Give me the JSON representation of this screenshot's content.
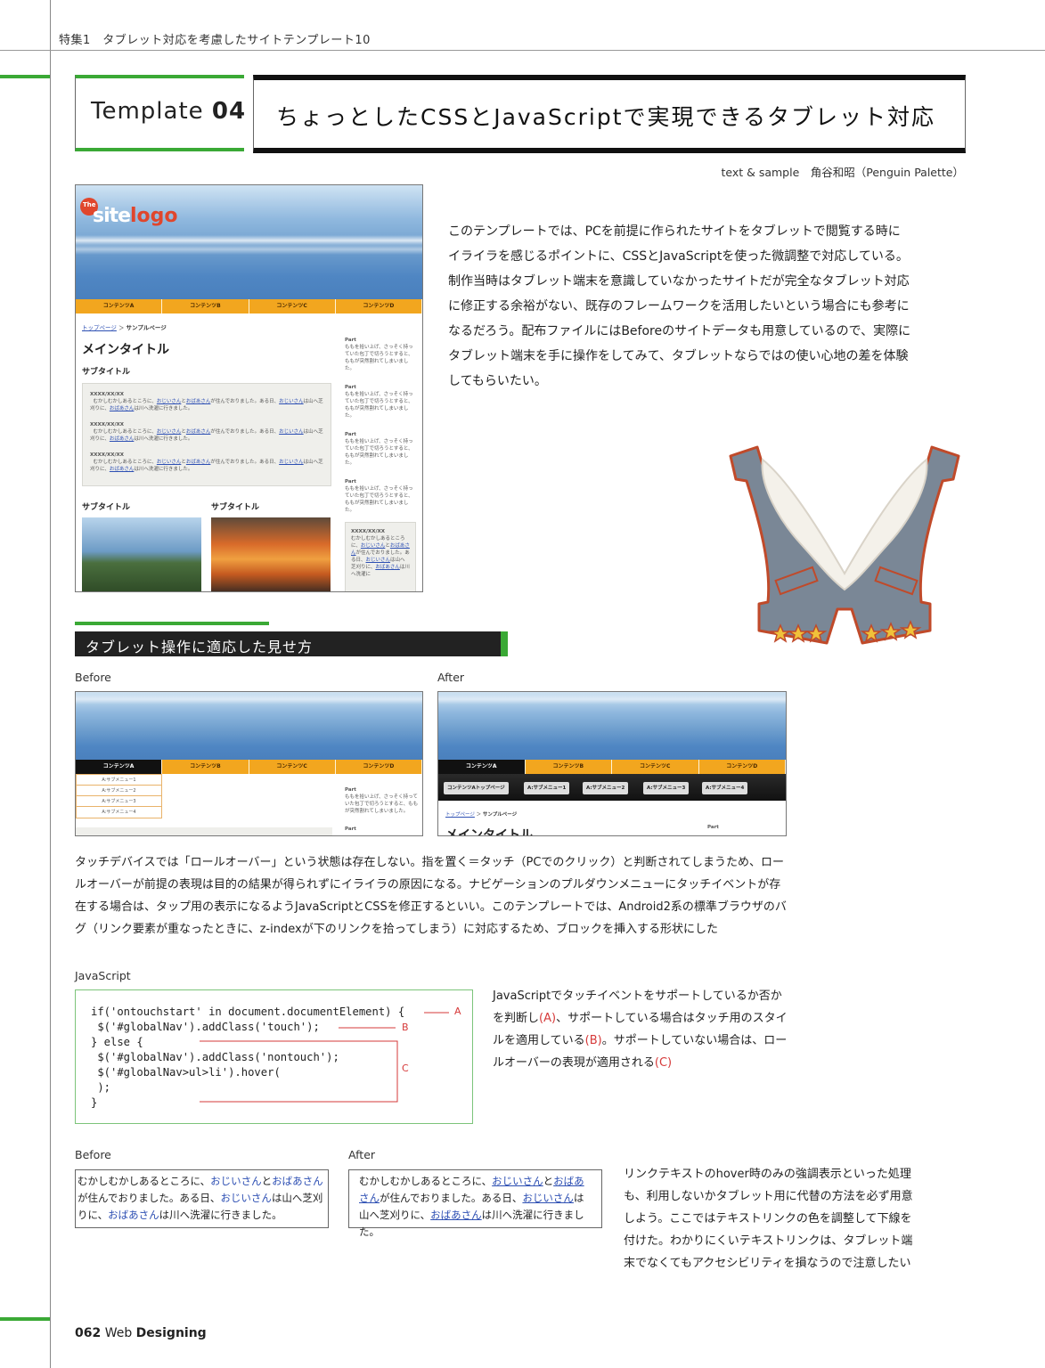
{
  "running_head": "特集1　タブレット対応を考慮したサイトテンプレート10",
  "template": {
    "prefix": "Template",
    "number": "04"
  },
  "title": "ちょっとしたCSSとJavaScriptで実現できるタブレット対応",
  "byline": "text & sample　角谷和昭（Penguin Palette）",
  "intro": "このテンプレートでは、PCを前提に作られたサイトをタブレットで閲覧する時にイライラを感じるポイントに、CSSとJavaScriptを使った微調整で対応している。制作当時はタブレット端末を意識していなかったサイトだが完全なタブレット対応に修正する余裕がない、既存のフレームワークを活用したいという場合にも参考になるだろう。配布ファイルにはBeforeのサイトデータも用意しているので、実際にタブレット端末を手に操作をしてみて、タブレットならではの使い心地の差を体験してもらいたい。",
  "mockup": {
    "logo_the": "The",
    "logo_site": "site",
    "logo_rest": "logo",
    "nav": [
      "コンテンツA",
      "コンテンツB",
      "コンテンツC",
      "コンテンツD"
    ],
    "breadcrumb_home": "トップページ",
    "breadcrumb_sep": "＞",
    "breadcrumb_current": "サンプルページ",
    "main_title": "メインタイトル",
    "sub_title": "サブタイトル",
    "date": "XXXX/XX/XX",
    "story_a": "むかしむかしあるところに、",
    "story_link1": "おじいさん",
    "story_and": "と",
    "story_link2": "おばあさん",
    "story_b": "が住んでおりました。ある日、",
    "story_c": "は山へ芝刈りに、",
    "story_d": "は川へ洗濯に行きました。",
    "side_part": "Part",
    "side_text": "ももを拾い上げ、さっそく持っていた包丁で切ろうとすると、ももが突然割れてしまいました。",
    "side_box_a": "むかしむかしあるところに、",
    "side_box_b": "が住んでおりました。ある日、",
    "side_box_c": "は山へ芝刈りに、",
    "side_box_d": "は川へ洗濯に"
  },
  "section_title": "タブレット操作に適応した見せ方",
  "before_label": "Before",
  "after_label": "After",
  "before_submenu": [
    "A:サブメニュー1",
    "A:サブメニュー2",
    "A:サブメニュー3",
    "A:サブメニュー4"
  ],
  "after_submenu": [
    "コンテンツAトップページ",
    "A:サブメニュー1",
    "A:サブメニュー2",
    "A:サブメニュー3",
    "A:サブメニュー4"
  ],
  "body_text": "タッチデバイスでは「ロールオーバー」という状態は存在しない。指を置く＝タッチ（PCでのクリック）と判断されてしまうため、ロールオーバーが前提の表現は目的の結果が得られずにイライラの原因になる。ナビゲーションのプルダウンメニューにタッチイベントが存在する場合は、タップ用の表示になるようJavaScriptとCSSを修正するといい。このテンプレートでは、Android2系の標準ブラウザのバグ（リンク要素が重なったときに、z-indexが下のリンクを拾ってしまう）に対応するため、ブロックを挿入する形状にした",
  "code_label": "JavaScript",
  "code_lines": [
    "if('ontouchstart' in document.documentElement) {",
    " $('#globalNav').addClass('touch');",
    "} else {",
    " $('#globalNav').addClass('nontouch');",
    " $('#globalNav>ul>li').hover(",
    " );",
    "}"
  ],
  "code_markers": {
    "a": "A",
    "b": "B",
    "c": "C"
  },
  "code_note_parts": {
    "p1": "JavaScriptでタッチイベントをサポートしているか否かを判断し",
    "a": "(A)",
    "p2": "、サポートしている場合はタッチ用のスタイルを適用している",
    "b": "(B)",
    "p3": "。サポートしていない場合は、ロールオーバーの表現が適用される",
    "c": "(C)"
  },
  "link_demo": {
    "t1": "むかしむかしあるところに、",
    "l1": "おじいさん",
    "t2": "と",
    "l2": "おばあさん",
    "t3": "が住んでおりました。ある日、",
    "t4": "は山へ芝刈りに、",
    "t5": "は川へ洗濯に行きました。"
  },
  "link_note": "リンクテキストのhover時のみの強調表示といった処理も、利用しないかタブレット用に代替の方法を必ず用意しよう。ここではテキストリンクの色を調整して下線を付けた。わかりにくいテキストリンクは、タブレット端末でなくてもアクセシビリティを損なうので注意したい",
  "folio": {
    "page": "062",
    "magazine_light": "Web",
    "magazine_bold": "Designing"
  },
  "colors": {
    "accent_green": "#3aa935",
    "nav_orange": "#f2a61f",
    "link_blue": "#2d4fb3",
    "marker_red": "#d63a3a"
  }
}
